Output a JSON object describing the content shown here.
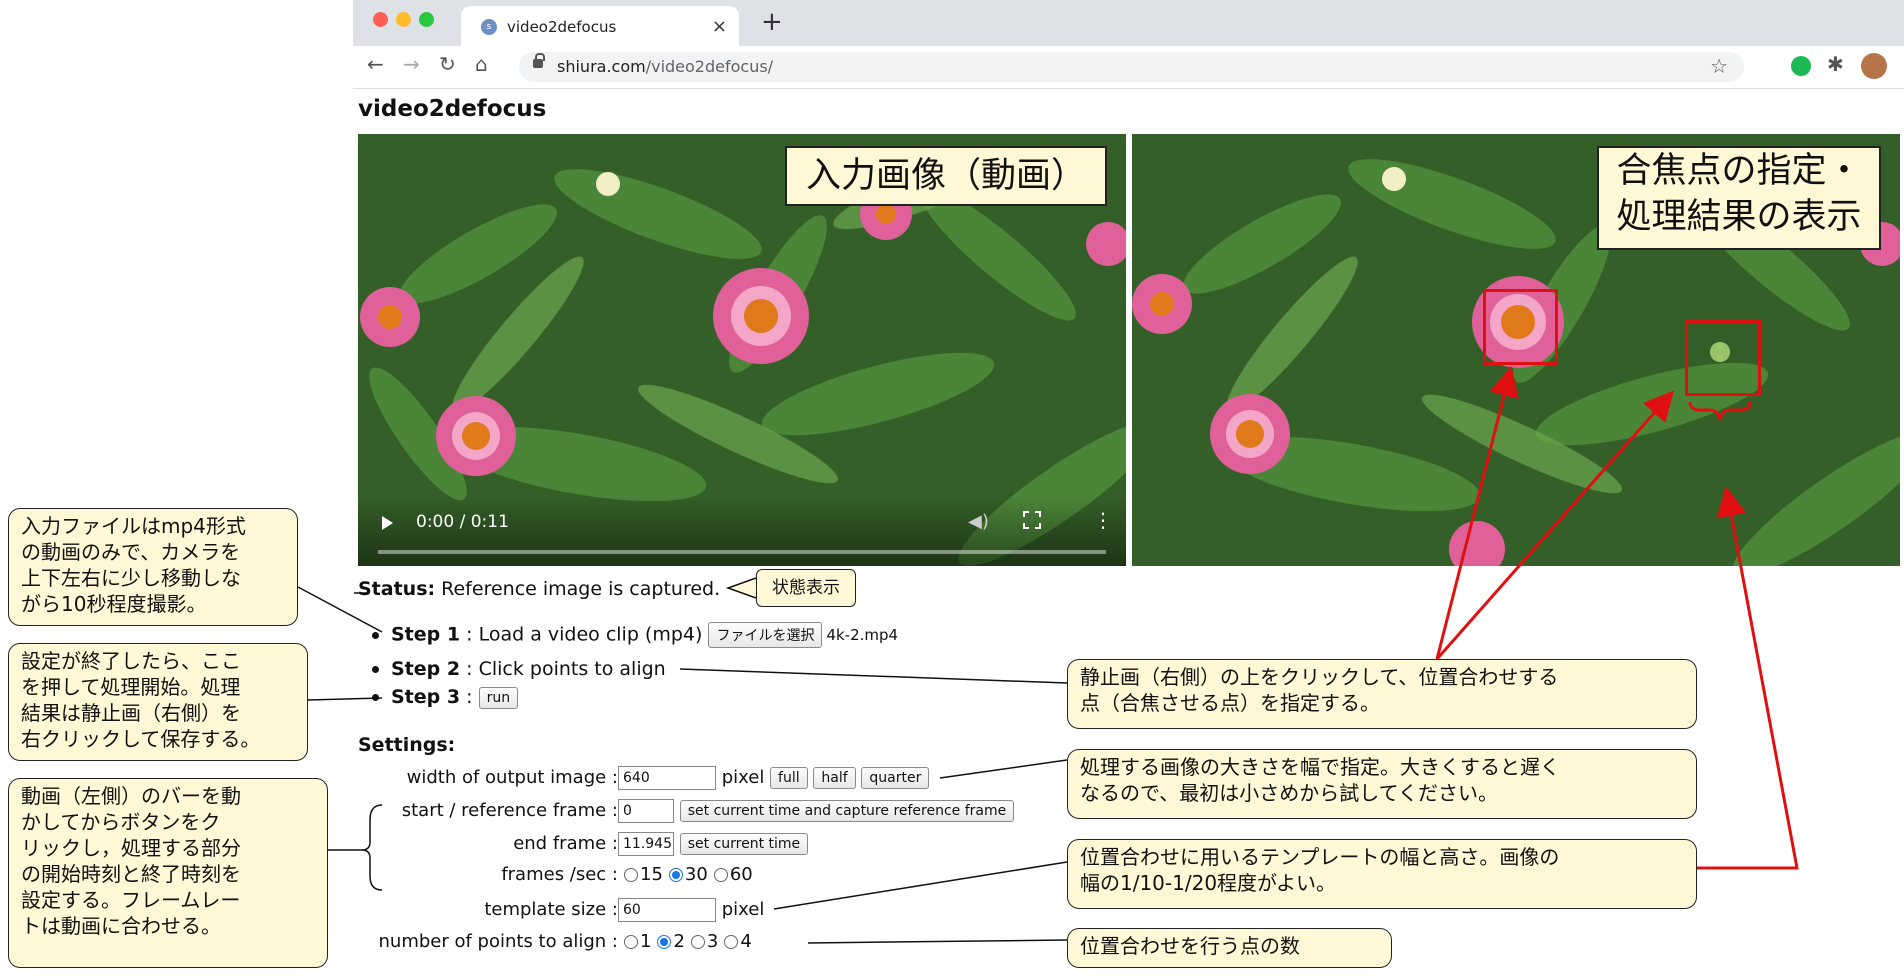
{
  "browser": {
    "tab_title": "video2defocus",
    "tab_favicon": "shiura-favicon",
    "close_label": "×",
    "new_tab_label": "+",
    "url_host": "shiura.com",
    "url_path": "/video2defocus/"
  },
  "page": {
    "title": "video2defocus"
  },
  "video": {
    "time": "0:00 / 0:11",
    "progress": 0
  },
  "banners": {
    "input": "入力画像（動画）",
    "output_line1": "合焦点の指定・",
    "output_line2": "処理結果の表示"
  },
  "status": {
    "label": "Status:",
    "text": " Reference image is captured."
  },
  "steps": {
    "step1_label": "Step 1",
    "step1_text": " : Load a video clip (mp4) ",
    "step1_button": "ファイルを選択",
    "step1_file": "4k-2.mp4",
    "step2_label": "Step 2",
    "step2_text": " : Click points to align",
    "step3_label": "Step 3",
    "step3_text": " : ",
    "step3_button": "run"
  },
  "settings": {
    "title": "Settings:",
    "width_label": "width of output image : ",
    "width_value": "640",
    "width_unit": " pixel ",
    "full_button": "full",
    "half_button": "half",
    "quarter_button": "quarter",
    "start_label": "start / reference frame : ",
    "start_value": "0",
    "start_button": "set current time and capture reference frame",
    "end_label": "end frame : ",
    "end_value": "11.945",
    "end_button": "set current time",
    "fps_label": "frames /sec : ",
    "fps_options": [
      "15",
      "30",
      "60"
    ],
    "fps_selected": "30",
    "template_label": "template size : ",
    "template_value": "60",
    "template_unit": " pixel",
    "points_label": "number of points to align : ",
    "points_options": [
      "1",
      "2",
      "3",
      "4"
    ],
    "points_selected": "2"
  },
  "callouts": {
    "status_tag": "状態表示",
    "input_file_1": "入力ファイルはmp4形式",
    "input_file_2": "の動画のみで、カメラを",
    "input_file_3": "上下左右に少し移動しな",
    "input_file_4": "がら10秒程度撮影。",
    "run_1": "設定が終了したら、ここ",
    "run_2": "を押して処理開始。処理",
    "run_3": "結果は静止画（右側）を",
    "run_4": "右クリックして保存する。",
    "frames_1": "動画（左側）のバーを動",
    "frames_2": "かしてからボタンをク",
    "frames_3": "リックし，処理する部分",
    "frames_4": "の開始時刻と終了時刻を",
    "frames_5": "設定する。フレームレー",
    "frames_6": "トは動画に合わせる。",
    "click_1": "静止画（右側）の上をクリックして、位置合わせする",
    "click_2": "点（合焦させる点）を指定する。",
    "width_1": "処理する画像の大きさを幅で指定。大きくすると遅く",
    "width_2": "なるので、最初は小さめから試してください。",
    "template_1": "位置合わせに用いるテンプレートの幅と高さ。画像の",
    "template_2": "幅の1/10-1/20程度がよい。",
    "points_1": "位置合わせを行う点の数"
  },
  "colors": {
    "callout_bg": "#fff8d6",
    "arrow": "#e01010",
    "radio_selected": "#1a73e8"
  }
}
